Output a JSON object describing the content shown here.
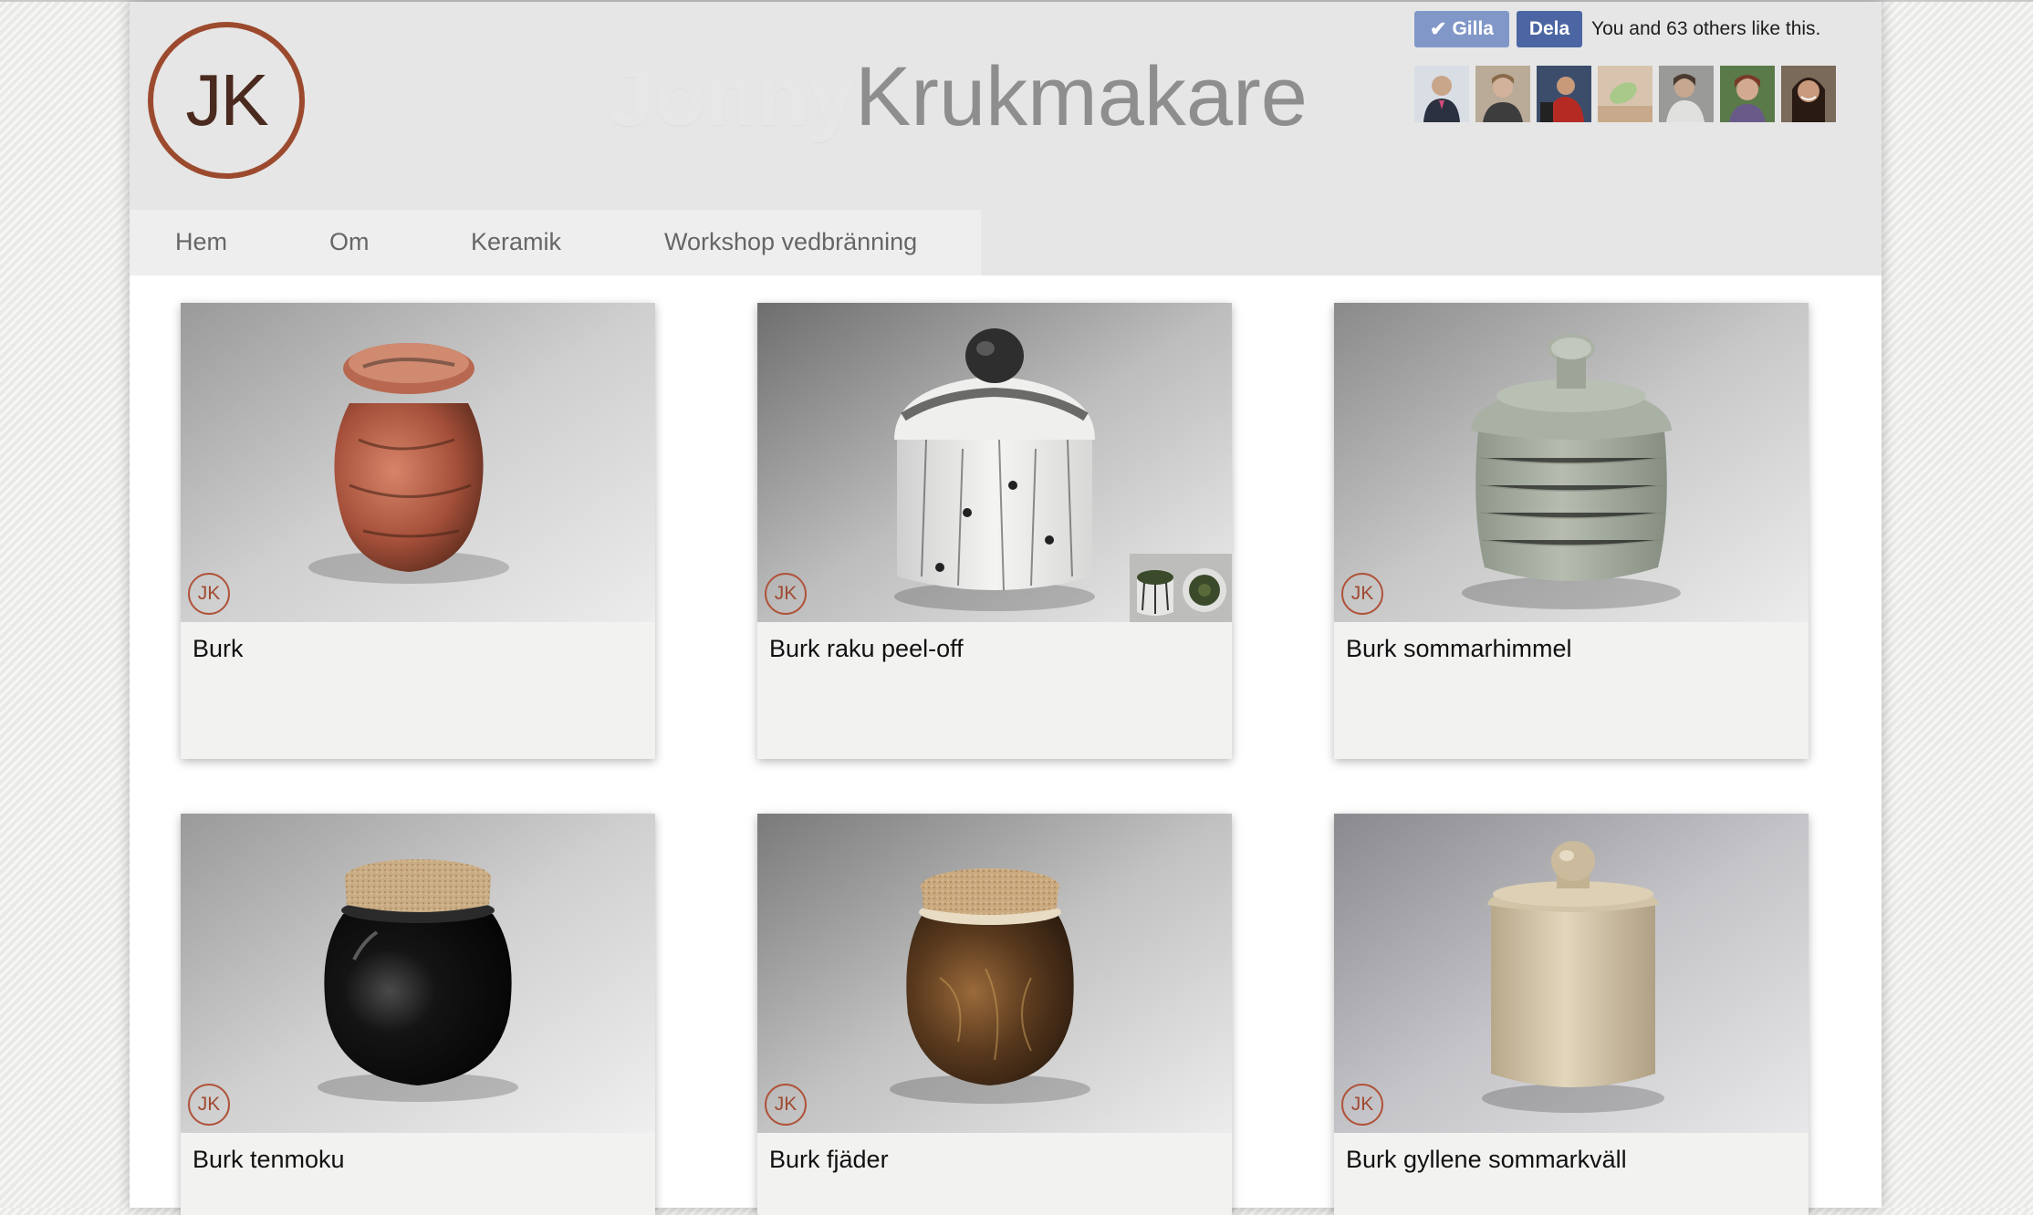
{
  "site": {
    "logo_text": "JK",
    "title_first": "Jonny",
    "title_last": "Krukmakare"
  },
  "facebook": {
    "like_label": "Gilla",
    "share_label": "Dela",
    "like_text": "You and 63 others like this.",
    "avatars": [
      "avatar-1",
      "avatar-2",
      "avatar-3",
      "avatar-4",
      "avatar-5",
      "avatar-6",
      "avatar-7"
    ]
  },
  "nav": {
    "items": [
      "Hem",
      "Om",
      "Keramik",
      "Workshop vedbränning"
    ]
  },
  "products": [
    {
      "title": "Burk",
      "badge": "JK"
    },
    {
      "title": "Burk raku peel-off",
      "badge": "JK"
    },
    {
      "title": "Burk sommarhimmel",
      "badge": "JK"
    },
    {
      "title": "Burk tenmoku",
      "badge": "JK"
    },
    {
      "title": "Burk fjäder",
      "badge": "JK"
    },
    {
      "title": "Burk gyllene sommarkväll",
      "badge": "JK"
    }
  ],
  "icons": {
    "check": "check-icon"
  },
  "colors": {
    "fb_like": "#8197c8",
    "fb_share": "#4c66a4",
    "logo_ring": "#9c4a2e",
    "badge": "#b0533a"
  }
}
